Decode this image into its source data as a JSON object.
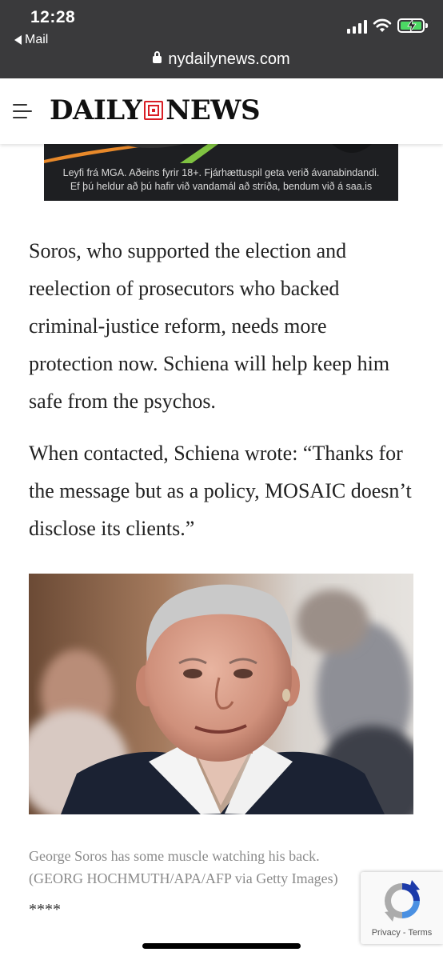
{
  "status_bar": {
    "time": "12:28",
    "back_label": "Mail",
    "url": "nydailynews.com"
  },
  "header": {
    "logo_left": "DAILY",
    "logo_right": "NEWS",
    "brand_color": "#d91f26"
  },
  "ad": {
    "line1": "Leyfi frá MGA. Aðeins fyrir 18+. Fjárhættuspil geta verið ávanabindandi.",
    "line2": "Ef þú heldur að þú hafir við vandamál að stríða, bendum við á saa.is"
  },
  "article": {
    "paragraphs": [
      "Soros, who supported the election and reelection of prosecutors who backed criminal-justice reform, needs more protection now. Schiena will help keep him safe from the psychos.",
      "When contacted, Schiena wrote: “Thanks for the message but as a policy, MOSAIC doesn’t disclose its clients.”"
    ]
  },
  "photo": {
    "caption_line1": "George Soros has some muscle watching his back.",
    "caption_line2": "(GEORG HOCHMUTH/APA/AFP via Getty Images)"
  },
  "separator": "****",
  "recaptcha": {
    "privacy": "Privacy",
    "sep": " - ",
    "terms": "Terms"
  },
  "icons": {
    "back": "back-arrow-icon",
    "lock": "lock-icon",
    "menu": "hamburger-menu-icon",
    "signal": "cellular-signal-icon",
    "wifi": "wifi-icon",
    "battery": "battery-charging-icon"
  }
}
